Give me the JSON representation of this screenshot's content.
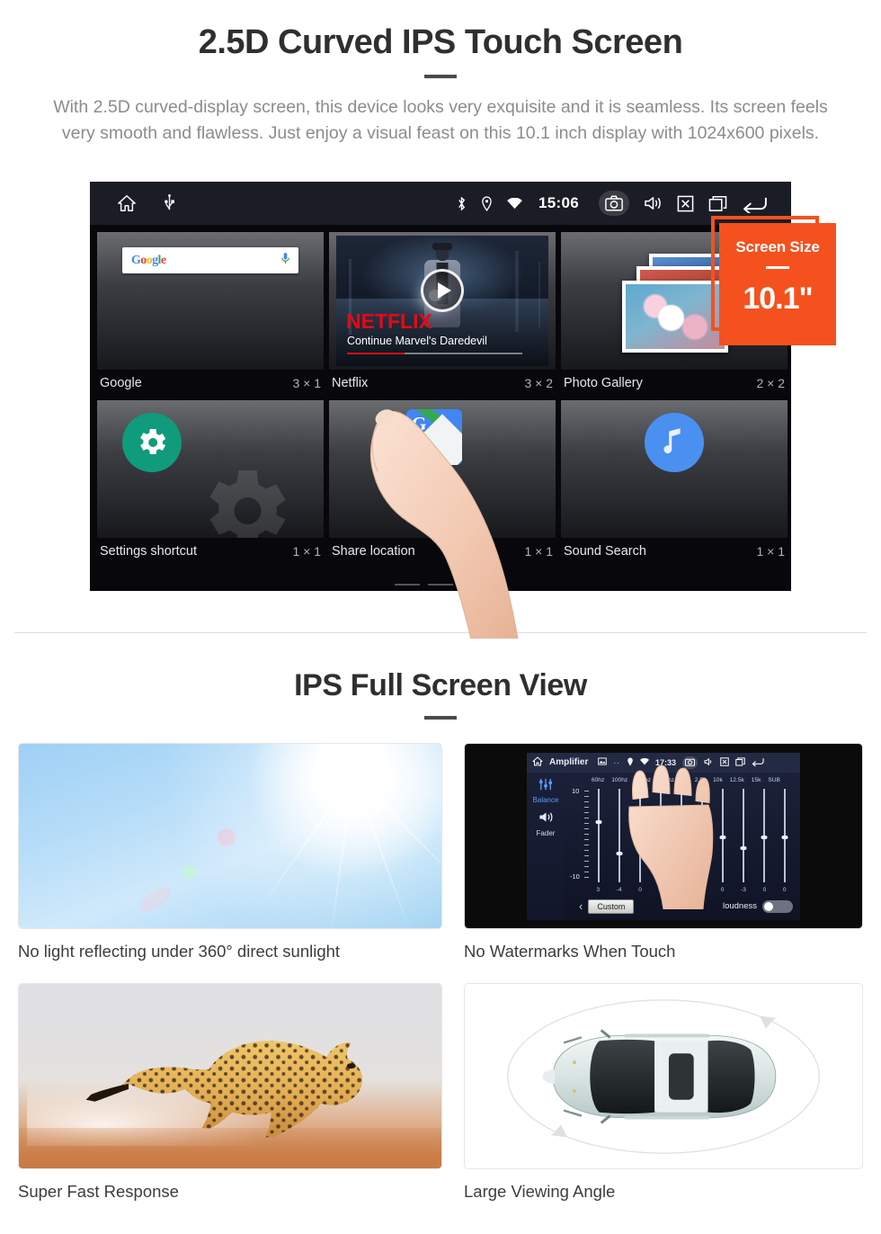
{
  "section1": {
    "title": "2.5D Curved IPS Touch Screen",
    "subtitle": "With 2.5D curved-display screen, this device looks very exquisite and it is seamless. Its screen feels very smooth and flawless. Just enjoy a visual feast on this 10.1 inch display with 1024x600 pixels."
  },
  "device_screen": {
    "statusbar": {
      "left_icons": [
        "home-icon",
        "usb-icon"
      ],
      "right_icons": [
        "bluetooth-icon",
        "location-icon",
        "wifi-icon"
      ],
      "time": "15:06",
      "action_icons": [
        "camera-icon",
        "volume-icon",
        "close-icon",
        "recents-icon",
        "back-icon"
      ]
    },
    "widgets": [
      {
        "name": "Google",
        "size": "3 × 1",
        "search_logo": "Google",
        "mic_icon": "microphone-icon"
      },
      {
        "name": "Netflix",
        "size": "3 × 2",
        "brand": "NETFLIX",
        "tagline": "Continue Marvel's Daredevil",
        "play_icon": "play-icon"
      },
      {
        "name": "Photo Gallery",
        "size": "2 × 2"
      },
      {
        "name": "Settings shortcut",
        "size": "1 × 1",
        "icon": "gear-icon"
      },
      {
        "name": "Share location",
        "size": "1 × 1",
        "icon": "google-maps-icon"
      },
      {
        "name": "Sound Search",
        "size": "1 × 1",
        "icon": "music-note-icon"
      }
    ],
    "page_indicator": {
      "count": 3,
      "active": 3
    }
  },
  "badge": {
    "label": "Screen Size",
    "value": "10.1\"",
    "color": "#f4511e"
  },
  "section2": {
    "title": "IPS Full Screen View",
    "cards": [
      {
        "caption": "No light reflecting under 360° direct sunlight",
        "media": "sunlight-photo"
      },
      {
        "caption": "No Watermarks When Touch",
        "media": "amplifier-screenshot"
      },
      {
        "caption": "Super Fast Response",
        "media": "cheetah-photo"
      },
      {
        "caption": "Large Viewing Angle",
        "media": "car-top-view-diagram"
      }
    ]
  },
  "amplifier": {
    "title": "Amplifier",
    "time": "17:33",
    "sidebar": [
      {
        "label": "Balance",
        "icon": "sliders-icon",
        "active": true
      },
      {
        "label": "Fader",
        "icon": "speaker-icon",
        "active": false
      }
    ],
    "scale_top": "10",
    "scale_bottom": "-10",
    "bands": [
      "60hz",
      "100hz",
      "200hz",
      "500hz",
      "1k",
      "2.5k",
      "10k",
      "12.5k",
      "15k",
      "SUB"
    ],
    "values": [
      "3",
      "-4",
      "0",
      "0",
      "0",
      "-3",
      "0",
      "-3",
      "0",
      "0"
    ],
    "preset": "Custom",
    "loudness_label": "loudness",
    "loudness_on": false,
    "back_icon": "chevron-left-icon"
  },
  "colors": {
    "accent": "#f4511e",
    "title": "#2f2f2f",
    "subtitle": "#8c8c8c",
    "netflix_red": "#e50914",
    "settings_green": "#0f9b7c",
    "sound_blue": "#4a90f0",
    "screen_bg": "#08080c"
  }
}
